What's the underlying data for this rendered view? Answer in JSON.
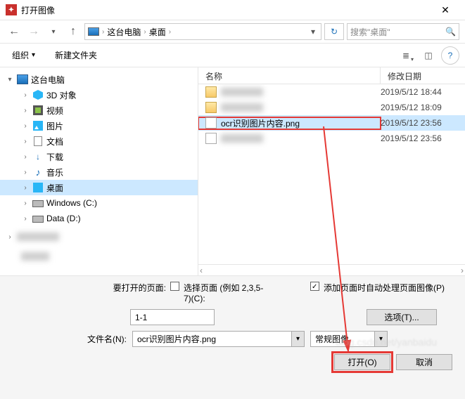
{
  "title": "打开图像",
  "nav": {
    "crumb1": "这台电脑",
    "crumb2": "桌面",
    "search_placeholder": "搜索\"桌面\""
  },
  "toolbar": {
    "organize": "组织",
    "newfolder": "新建文件夹"
  },
  "tree": {
    "root": "这台电脑",
    "items": [
      "3D 对象",
      "视频",
      "图片",
      "文档",
      "下载",
      "音乐",
      "桌面",
      "Windows (C:)",
      "Data (D:)"
    ]
  },
  "list": {
    "col_name": "名称",
    "col_date": "修改日期",
    "rows": [
      {
        "name": "",
        "date": "2019/5/12 18:44",
        "folder": true,
        "blur": true
      },
      {
        "name": "",
        "date": "2019/5/12 18:09",
        "folder": true,
        "blur": true
      },
      {
        "name": "ocr识别图片内容.png",
        "date": "2019/5/12 23:56",
        "selected": true
      },
      {
        "name": "",
        "date": "2019/5/12 23:56",
        "blur": true
      }
    ]
  },
  "bottom": {
    "pages_label": "要打开的页面:",
    "select_pages": "选择页面 (例如 2,3,5-7)(C):",
    "auto_process": "添加页面时自动处理页面图像(P)",
    "page_range": "1-1",
    "options_btn": "选项(T)...",
    "filename_label": "文件名(N):",
    "filename_value": "ocr识别图片内容.png",
    "filter": "常规图像",
    "open_btn": "打开(O)",
    "cancel_btn": "取消"
  },
  "row2_spacer": " ",
  "watermark": "blog.csdn.net/yanbaidu"
}
